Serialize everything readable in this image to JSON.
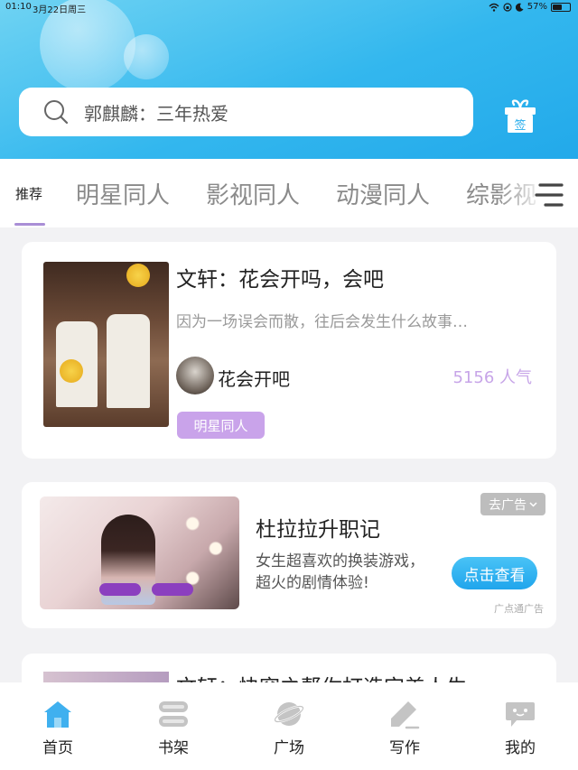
{
  "status_bar": {
    "time": "01:10",
    "date": "3月22日周三",
    "battery": "57%",
    "battery_level": 0.57
  },
  "search": {
    "placeholder": "郭麒麟：三年热爱"
  },
  "gift": {
    "label": "签"
  },
  "tabs": [
    {
      "label": "推荐",
      "active": true
    },
    {
      "label": "明星同人"
    },
    {
      "label": "影视同人"
    },
    {
      "label": "动漫同人"
    },
    {
      "label": "综影视"
    }
  ],
  "cards": [
    {
      "title": "文轩：花会开吗，会吧",
      "description": "因为一场误会而散，往后会发生什么故事…",
      "author": "花会开吧",
      "popularity": "5156 人气",
      "tag": "明星同人"
    }
  ],
  "ad": {
    "close_label": "去广告",
    "title": "杜拉拉升职记",
    "description": "女生超喜欢的换装游戏，超火的剧情体验!",
    "cta": "点击查看",
    "source": "广点通广告"
  },
  "partial_card": {
    "title": "文轩：快穿之帮你打造完美人生"
  },
  "bottom_nav": [
    {
      "label": "首页",
      "icon": "home-icon",
      "active": true
    },
    {
      "label": "书架",
      "icon": "bookshelf-icon"
    },
    {
      "label": "广场",
      "icon": "planet-icon"
    },
    {
      "label": "写作",
      "icon": "pen-icon"
    },
    {
      "label": "我的",
      "icon": "chat-bubble-icon"
    }
  ],
  "colors": {
    "header": "#33b7ee",
    "accent": "#a98ed6",
    "tag": "#c9a3ea",
    "popularity": "#c7a5e8",
    "cta": "#20a5ec",
    "nav_active": "#3fb0ef",
    "nav_inactive": "#c4c4c4"
  }
}
